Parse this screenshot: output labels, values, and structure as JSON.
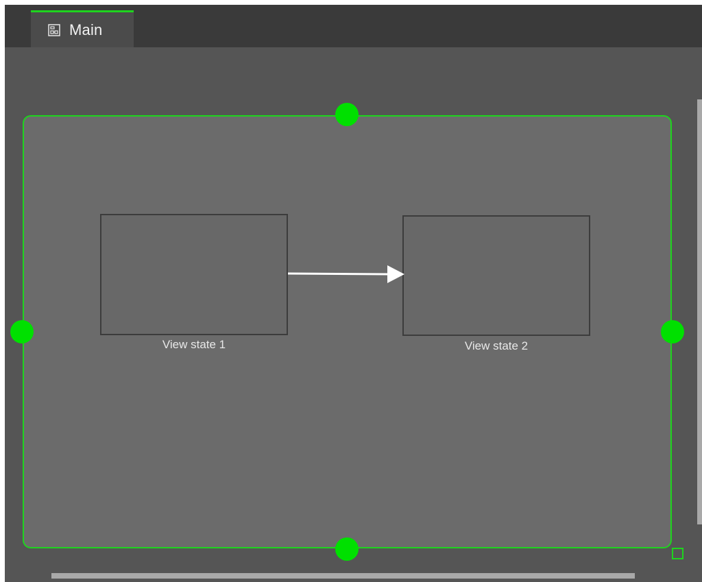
{
  "tabs": [
    {
      "label": "Main",
      "icon": "state-machine-icon",
      "active": true
    }
  ],
  "diagram": {
    "states": [
      {
        "label": "View state 1"
      },
      {
        "label": "View state 2"
      }
    ],
    "transitions": [
      {
        "from": "View state 1",
        "to": "View state 2"
      }
    ]
  },
  "colors": {
    "accent": "#1ed41e",
    "handle": "#00e000",
    "tabbar_bg": "#3a3a3a",
    "canvas_bg": "#555555",
    "frame_bg": "#6b6b6b",
    "state_border": "#3c3c3c",
    "arrow": "#ffffff",
    "scrollbar": "#a9a9a9"
  }
}
